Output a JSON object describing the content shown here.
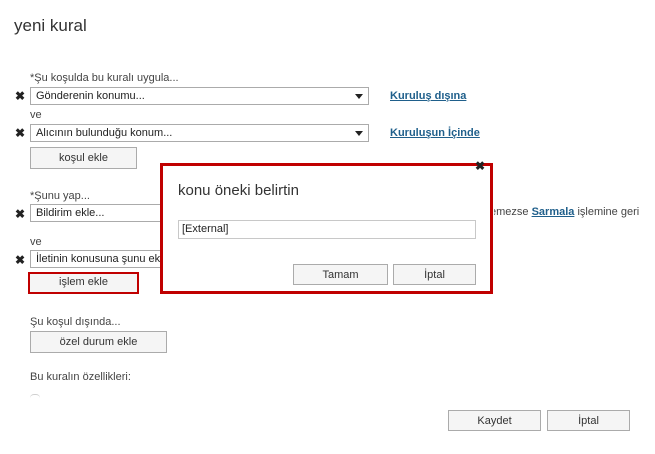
{
  "page": {
    "title": "yeni kural"
  },
  "condition": {
    "label": "*Şu koşulda bu kuralı uygula...",
    "rows": [
      {
        "select": "Gönderenin konumu...",
        "value_link": "Kuruluş dışına"
      },
      {
        "select": "Alıcının bulunduğu konum...",
        "value_link": "Kuruluşun İçinde"
      }
    ],
    "and_label": "ve",
    "add_button": "koşul ekle"
  },
  "action": {
    "label": "*Şunu yap...",
    "rows": [
      {
        "select": "Bildirim ekle..."
      },
      {
        "select": "İletinin konusuna şunu ekle..."
      }
    ],
    "and_label": "ve",
    "fallback_text_prefix": "emezse ",
    "fallback_link": "Sarmala",
    "fallback_text_suffix": " işlemine geri",
    "add_button": "işlem ekle"
  },
  "exception": {
    "label": "Şu koşul dışında...",
    "add_button": "özel durum ekle"
  },
  "properties": {
    "label": "Bu kuralın özellikleri:"
  },
  "footer": {
    "save_label": "Kaydet",
    "cancel_label": "İptal"
  },
  "dialog": {
    "title": "konu öneki belirtin",
    "input_value": "[External]",
    "close_glyph": "✖",
    "ok_label": "Tamam",
    "cancel_label": "İptal"
  },
  "icons": {
    "remove": "✖"
  },
  "colors": {
    "highlight": "#c00000",
    "link": "#1f5f8b"
  }
}
